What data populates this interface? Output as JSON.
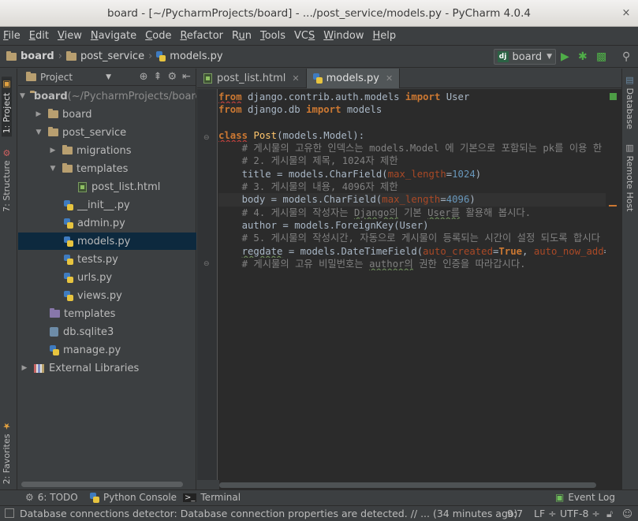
{
  "window": {
    "title": "board - [~/PycharmProjects/board] - .../post_service/models.py - PyCharm 4.0.4",
    "close_glyph": "×"
  },
  "menu": [
    "File",
    "Edit",
    "View",
    "Navigate",
    "Code",
    "Refactor",
    "Run",
    "Tools",
    "VCS",
    "Window",
    "Help"
  ],
  "breadcrumbs": [
    "board",
    "post_service",
    "models.py"
  ],
  "run_config": {
    "label": "board"
  },
  "project_panel": {
    "title": "Project",
    "tree": [
      {
        "label": "board",
        "suffix": " (~/PycharmProjects/board",
        "icon": "folder-icon",
        "expanded": true,
        "bold": true
      },
      {
        "label": "board",
        "icon": "folder-icon",
        "expanded": false
      },
      {
        "label": "post_service",
        "icon": "folder-icon",
        "expanded": true
      },
      {
        "label": "migrations",
        "icon": "folder-icon",
        "expanded": false
      },
      {
        "label": "templates",
        "icon": "folder-icon",
        "expanded": true
      },
      {
        "label": "post_list.html",
        "icon": "html-file-icon"
      },
      {
        "label": "__init__.py",
        "icon": "python-file-icon"
      },
      {
        "label": "admin.py",
        "icon": "python-file-icon"
      },
      {
        "label": "models.py",
        "icon": "python-file-icon",
        "selected": true
      },
      {
        "label": "tests.py",
        "icon": "python-file-icon"
      },
      {
        "label": "urls.py",
        "icon": "python-file-icon"
      },
      {
        "label": "views.py",
        "icon": "python-file-icon"
      },
      {
        "label": "templates",
        "icon": "folder-icon"
      },
      {
        "label": "db.sqlite3",
        "icon": "database-icon"
      },
      {
        "label": "manage.py",
        "icon": "python-file-icon"
      },
      {
        "label": "External Libraries",
        "icon": "library-icon",
        "expanded": false
      }
    ]
  },
  "editor_tabs": [
    {
      "label": "post_list.html",
      "active": false
    },
    {
      "label": "models.py",
      "active": true
    }
  ],
  "code_lines": [
    "from django.contrib.auth.models import User",
    "from django.db import models",
    "",
    "class Post(models.Model):",
    "    # 게시물의 고유한 인덱스는 models.Model 에 기본으로 포함되는 pk를 이용 한",
    "    # 2. 게시물의 제목, 1024자 제한",
    "    title = models.CharField(max_length=1024)",
    "    # 3. 게시물의 내용, 4096자 제한",
    "    body = models.CharField(max_length=4096)",
    "    # 4. 게시물의 작성자는 Django의 기본 User를 활용해 봅시다.",
    "    author = models.ForeignKey(User)",
    "    # 5. 게시물의 작성시간, 자동으로 게시물이 등록되는 시간이 설정 되도록 합시다",
    "    regdate = models.DateTimeField(auto_created=True, auto_now_add=True)",
    "    # 게시물의 고유 비밀번호는 author의 권한 인증을 따라갑시다."
  ],
  "left_stripe": [
    "1: Project",
    "7: Structure",
    "2: Favorites"
  ],
  "right_stripe": [
    "Database",
    "Remote Host"
  ],
  "bottom_tools": [
    {
      "label": "6: TODO",
      "icon": "todo-icon"
    },
    {
      "label": "Python Console",
      "icon": "python-console-icon"
    },
    {
      "label": "Terminal",
      "icon": "terminal-icon"
    },
    {
      "label": "Event Log",
      "icon": "event-log-icon"
    }
  ],
  "status": {
    "message": "Database connections detector: Database connection properties are detected. // ... (34 minutes ago)",
    "position": "9:7",
    "line_sep": "LF ÷",
    "encoding": "UTF-8 ÷"
  }
}
